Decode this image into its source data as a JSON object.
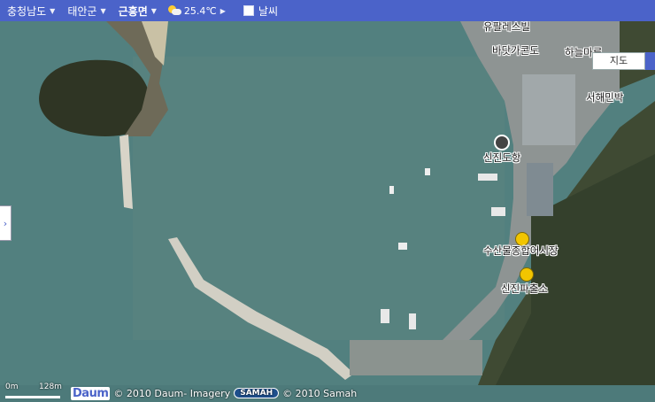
{
  "breadcrumb": {
    "province": "충청남도",
    "county": "태안군",
    "town": "근흥면"
  },
  "weather": {
    "temperature": "25.4℃",
    "toggle_label": "날씨"
  },
  "map_type": {
    "label": "지도"
  },
  "labels": {
    "top_building": "유팔레스빌",
    "hotel": "바닷가콘도",
    "sky_house": "하늘마루",
    "seohae_inn": "서해민박",
    "port": "신진도항",
    "market": "수산물종합어시장",
    "police": "신진파출소"
  },
  "scale": {
    "zero": "0m",
    "distance": "128m"
  },
  "attribution": {
    "daum": "© 2010 Daum- Imagery",
    "samah_logo": "SAMAH",
    "samah": "© 2010 Samah"
  },
  "icons": {
    "port": "anchor-pin-icon",
    "market": "market-pin-icon",
    "police": "police-pin-icon"
  }
}
